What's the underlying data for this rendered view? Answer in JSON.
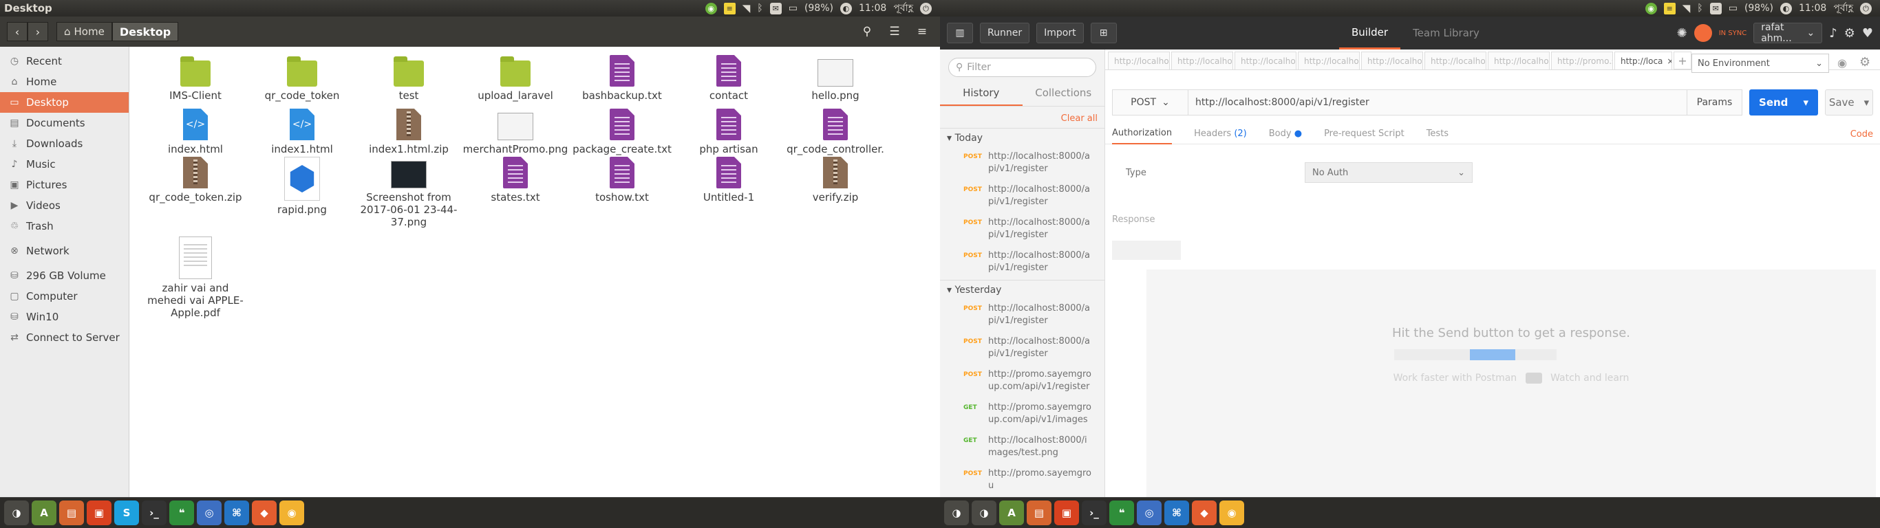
{
  "screen1": {
    "topbar": {
      "title": "Desktop",
      "battery": "(98%)",
      "time": "11:08",
      "date_script": "পূর্বাহ্ণ"
    },
    "header": {
      "back": "‹",
      "forward": "›",
      "home_crumb": "Home",
      "current_crumb": "Desktop"
    },
    "sidebar": {
      "items": [
        "Recent",
        "Home",
        "Desktop",
        "Documents",
        "Downloads",
        "Music",
        "Pictures",
        "Videos",
        "Trash",
        "Network",
        "296 GB Volume",
        "Computer",
        "Win10",
        "Connect to Server"
      ],
      "selected": "Desktop"
    },
    "files": [
      {
        "name": "IMS-Client",
        "type": "folder"
      },
      {
        "name": "qr_code_token",
        "type": "folder"
      },
      {
        "name": "test",
        "type": "folder"
      },
      {
        "name": "upload_laravel",
        "type": "folder"
      },
      {
        "name": "bashbackup.txt",
        "type": "doc"
      },
      {
        "name": "contact",
        "type": "doc"
      },
      {
        "name": "hello.png",
        "type": "image"
      },
      {
        "name": "index.html",
        "type": "html"
      },
      {
        "name": "index1.html",
        "type": "html"
      },
      {
        "name": "index1.html.zip",
        "type": "zip"
      },
      {
        "name": "merchantPromo.png",
        "type": "image"
      },
      {
        "name": "package_create.txt",
        "type": "doc"
      },
      {
        "name": "php artisan",
        "type": "doc"
      },
      {
        "name": "qr_code_controller.\ntxt",
        "type": "doc"
      },
      {
        "name": "qr_code_token.zip",
        "type": "zip"
      },
      {
        "name": "rapid.png",
        "type": "rapid"
      },
      {
        "name": "Screenshot from\n2017-06-01 23-44-\n37.png",
        "type": "dark"
      },
      {
        "name": "states.txt",
        "type": "doc"
      },
      {
        "name": "toshow.txt",
        "type": "doc"
      },
      {
        "name": "Untitled-1",
        "type": "doc"
      },
      {
        "name": "verify.zip",
        "type": "zip"
      },
      {
        "name": "zahir vai and\nmehedi vai APPLE-\nApple.pdf",
        "type": "pdf"
      }
    ]
  },
  "screen2": {
    "topbar": {
      "title": "",
      "battery": "(98%)",
      "time": "11:08",
      "date_script": "পূর্বাহ্ণ"
    },
    "toolbar": {
      "runner": "Runner",
      "import": "Import",
      "builder": "Builder",
      "team_library": "Team Library",
      "sync": "IN SYNC",
      "user": "rafat ahm..."
    },
    "sidebar": {
      "filter_placeholder": "Filter",
      "tabs": [
        "History",
        "Collections"
      ],
      "clear_all": "Clear all",
      "today_label": "Today",
      "yesterday_label": "Yesterday",
      "today": [
        {
          "method": "POST",
          "url": "http://localhost:8000/api/v1/register"
        },
        {
          "method": "POST",
          "url": "http://localhost:8000/api/v1/register"
        },
        {
          "method": "POST",
          "url": "http://localhost:8000/api/v1/register"
        },
        {
          "method": "POST",
          "url": "http://localhost:8000/api/v1/register"
        }
      ],
      "yesterday": [
        {
          "method": "POST",
          "url": "http://localhost:8000/api/v1/register"
        },
        {
          "method": "POST",
          "url": "http://localhost:8000/api/v1/register"
        },
        {
          "method": "POST",
          "url": "http://promo.sayemgroup.com/api/v1/register"
        },
        {
          "method": "GET",
          "url": "http://promo.sayemgroup.com/api/v1/images"
        },
        {
          "method": "GET",
          "url": "http://localhost:8000/images/test.png"
        },
        {
          "method": "POST",
          "url": "http://promo.sayemgrou"
        }
      ]
    },
    "request_tabs": [
      "http://localhost",
      "http://localhost",
      "http://localhost",
      "http://localhost",
      "http://localhost",
      "http://localhost",
      "http://localhost",
      "http://promo.sa",
      "http://loca"
    ],
    "environment": "No Environment",
    "request": {
      "method": "POST",
      "url": "http://localhost:8000/api/v1/register",
      "params": "Params",
      "send": "Send",
      "save": "Save"
    },
    "req_tabs": {
      "authorization": "Authorization",
      "headers": "Headers",
      "headers_count": "(2)",
      "body": "Body",
      "prerequest": "Pre-request Script",
      "tests": "Tests",
      "code": "Code"
    },
    "auth": {
      "type_label": "Type",
      "type_value": "No Auth"
    },
    "response": {
      "label": "Response",
      "hint": "Hit the Send button to get a response.",
      "footer": "Work faster with Postman",
      "watch": "Watch and learn"
    }
  },
  "colors": {
    "accent": "#e8764f",
    "postman_orange": "#f26b3a",
    "send_blue": "#1b72e8",
    "folder_green": "#a9c63a",
    "doc_purple": "#8a3b9e"
  }
}
